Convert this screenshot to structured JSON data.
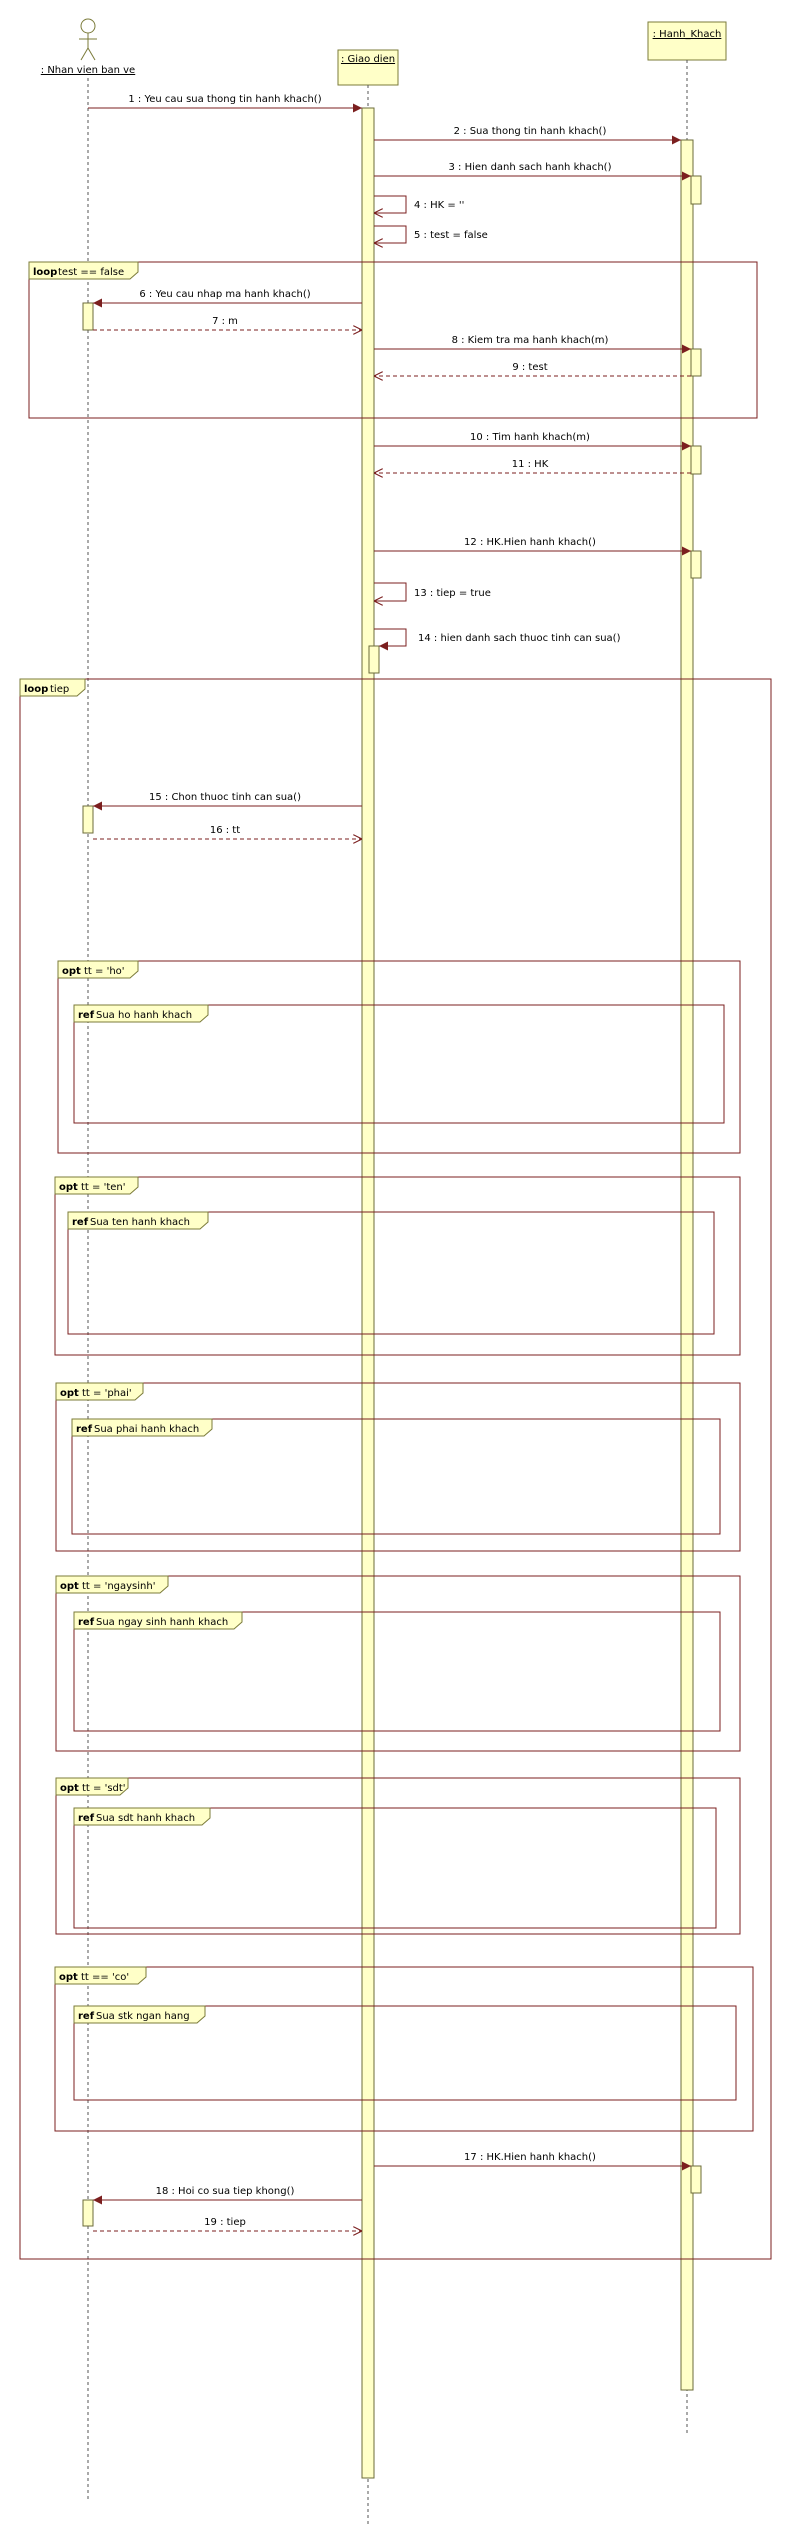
{
  "lifelines": {
    "actor": ": Nhan vien ban ve",
    "ui": ": Giao dien",
    "hk": ": Hanh_Khach"
  },
  "messages": [
    {
      "label": "1 : Yeu cau sua thong tin hanh khach()"
    },
    {
      "label": "2 : Sua thong tin hanh khach()"
    },
    {
      "label": "3 : Hien danh sach hanh khach()"
    },
    {
      "label": "4 : HK = ''"
    },
    {
      "label": "5 : test = false"
    },
    {
      "label": "6 : Yeu cau nhap ma hanh khach()"
    },
    {
      "label": "7 : m"
    },
    {
      "label": "8 : Kiem tra ma hanh khach(m)"
    },
    {
      "label": "9 : test"
    },
    {
      "label": "10 : Tim hanh khach(m)"
    },
    {
      "label": "11 : HK"
    },
    {
      "label": "12 : HK.Hien hanh khach()"
    },
    {
      "label": "13 : tiep = true"
    },
    {
      "label": "14 : hien danh sach thuoc tinh can sua()"
    },
    {
      "label": "15 : Chon thuoc tinh can sua()"
    },
    {
      "label": "16 : tt"
    },
    {
      "label": "17 : HK.Hien hanh khach()"
    },
    {
      "label": "18 : Hoi co sua tiep khong()"
    },
    {
      "label": "19 : tiep"
    }
  ],
  "fragments": {
    "loop1": {
      "keyword": "loop",
      "guard": "test == false"
    },
    "loop2": {
      "keyword": "loop",
      "guard": "tiep"
    },
    "opts": [
      {
        "keyword": "opt",
        "guard": "tt = 'ho'",
        "ref": "Sua ho hanh khach"
      },
      {
        "keyword": "opt",
        "guard": "tt = 'ten'",
        "ref": "Sua ten hanh khach"
      },
      {
        "keyword": "opt",
        "guard": "tt = 'phai'",
        "ref": "Sua phai hanh khach"
      },
      {
        "keyword": "opt",
        "guard": "tt = 'ngaysinh'",
        "ref": "Sua ngay sinh hanh khach"
      },
      {
        "keyword": "opt",
        "guard": "tt = 'sdt'",
        "ref": "Sua sdt hanh khach"
      },
      {
        "keyword": "opt",
        "guard": "tt == 'co'",
        "ref": "Sua stk ngan hang"
      }
    ],
    "ref_keyword": "ref"
  },
  "colors": {
    "frame": "#7b1f1f",
    "activation_fill": "#ffffc8",
    "activation_stroke": "#6b6b3a",
    "arrow": "#7b1f1f",
    "label_tab": "#ffffc8"
  }
}
